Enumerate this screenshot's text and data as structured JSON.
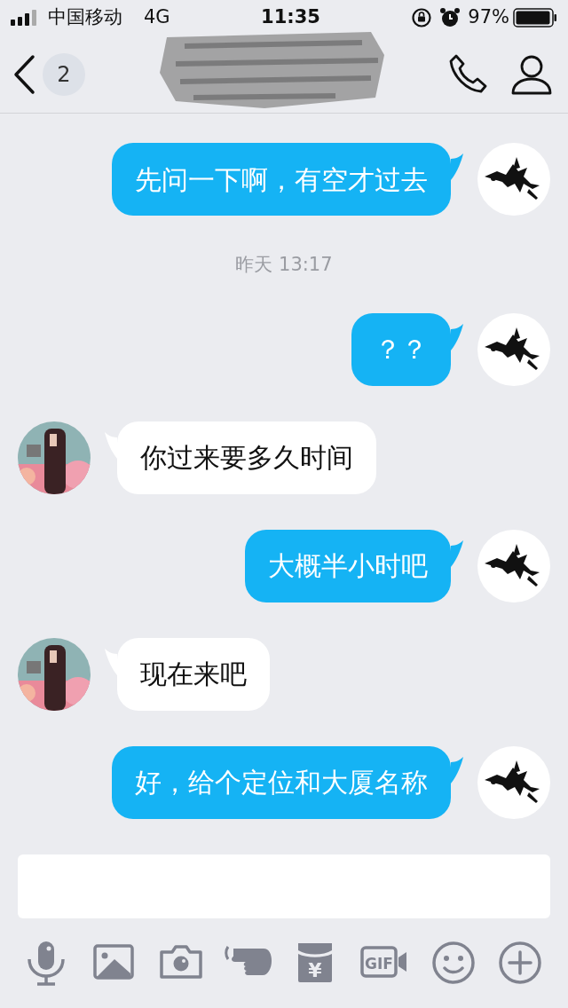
{
  "status_bar": {
    "carrier": "中国移动",
    "network": "4G",
    "time": "11:35",
    "battery": "97%"
  },
  "header": {
    "back_badge": "2"
  },
  "messages": [
    {
      "kind": "sent",
      "text": "先问一下啊，有空才过去"
    },
    {
      "kind": "time",
      "text": "昨天 13:17"
    },
    {
      "kind": "sent",
      "text": "？？"
    },
    {
      "kind": "received",
      "text": "你过来要多久时间"
    },
    {
      "kind": "sent",
      "text": "大概半小时吧"
    },
    {
      "kind": "received",
      "text": "现在来吧"
    },
    {
      "kind": "sent",
      "text": "好，给个定位和大厦名称"
    }
  ],
  "toolbar": {
    "red_packet_label": "¥",
    "gif_label": "GIF"
  }
}
